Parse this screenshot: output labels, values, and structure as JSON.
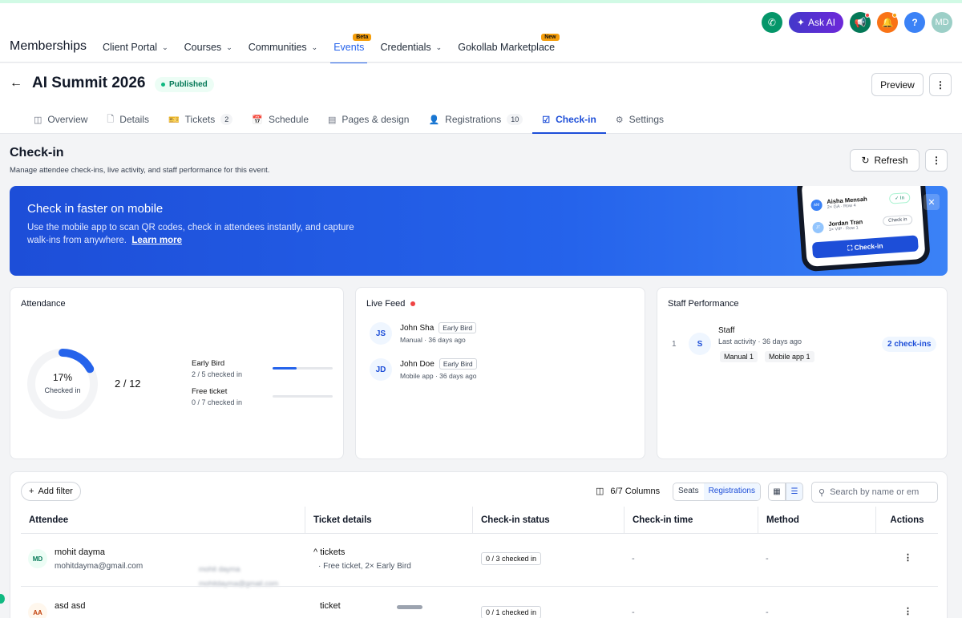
{
  "topbar": {
    "brand": "Memberships",
    "nav": [
      {
        "label": "Client Portal",
        "chevron": true
      },
      {
        "label": "Courses",
        "chevron": true
      },
      {
        "label": "Communities",
        "chevron": true
      },
      {
        "label": "Events",
        "chevron": false,
        "tag": "Beta",
        "active": true
      },
      {
        "label": "Credentials",
        "chevron": true
      },
      {
        "label": "Gokollab Marketplace",
        "chevron": false,
        "tag": "New"
      }
    ],
    "ask_ai": "Ask AI",
    "user_initials": "MD"
  },
  "header": {
    "title": "AI Summit 2026",
    "status": "Published",
    "preview": "Preview",
    "tabs": [
      {
        "label": "Overview"
      },
      {
        "label": "Details"
      },
      {
        "label": "Tickets",
        "count": "2"
      },
      {
        "label": "Schedule"
      },
      {
        "label": "Pages & design"
      },
      {
        "label": "Registrations",
        "count": "10"
      },
      {
        "label": "Check-in",
        "active": true
      },
      {
        "label": "Settings"
      }
    ]
  },
  "checkin": {
    "title": "Check-in",
    "subtitle": "Manage attendee check-ins, live activity, and staff performance for this event.",
    "refresh": "Refresh"
  },
  "banner": {
    "title": "Check in faster on mobile",
    "text": "Use the mobile app to scan QR codes, check in attendees instantly, and capture walk-ins from anywhere.",
    "link": "Learn more",
    "phone": {
      "row1_name": "Aisha Mensah",
      "row1_initials": "AM",
      "row1_sub": "2× GA · Row 4",
      "row1_status": "✓ In",
      "row2_name": "Jordan Tran",
      "row2_initials": "JT",
      "row2_sub": "1× VIP · Row 1",
      "row2_action": "Check in",
      "button": "Check-in"
    }
  },
  "attendance": {
    "title": "Attendance",
    "percent": "17%",
    "percent_value": 0.17,
    "label": "Checked in",
    "ratio": "2 / 12",
    "tickets": [
      {
        "name": "Early Bird",
        "sub": "2 / 5 checked in",
        "fill": 0.4
      },
      {
        "name": "Free ticket",
        "sub": "0 / 7 checked in",
        "fill": 0
      }
    ]
  },
  "live_feed": {
    "title": "Live Feed",
    "items": [
      {
        "initials": "JS",
        "name": "John Sha",
        "ticket": "Early Bird",
        "sub": "Manual · 36 days ago"
      },
      {
        "initials": "JD",
        "name": "John Doe",
        "ticket": "Early Bird",
        "sub": "Mobile app · 36 days ago"
      }
    ]
  },
  "staff": {
    "title": "Staff Performance",
    "rank": "1",
    "initial": "S",
    "name": "Staff",
    "activity": "Last activity · 36 days ago",
    "chips": [
      "Manual 1",
      "Mobile app 1"
    ],
    "count": "2 check-ins"
  },
  "table": {
    "add_filter": "Add filter",
    "columns_label": "6/7 Columns",
    "seg": [
      "Seats",
      "Registrations"
    ],
    "search_placeholder": "Search by name or em",
    "headers": [
      "Attendee",
      "Ticket details",
      "Check-in status",
      "Check-in time",
      "Method",
      "Actions"
    ],
    "rows": [
      {
        "initials": "MD",
        "name": "mohit dayma",
        "email": "mohitdayma@gmail.com",
        "ticket_line1": "^ tickets",
        "ticket_line2": "· Free ticket, 2× Early Bird",
        "status": "0 / 3 checked in",
        "time": "-",
        "method": "-",
        "action": "⋮"
      },
      {
        "initials": "AA",
        "name": "asd asd",
        "email": "",
        "ticket_line1": "ticket",
        "ticket_line2": "",
        "status": "0 / 1 checked in",
        "time": "-",
        "method": "-",
        "action": "⋮"
      }
    ],
    "ghost_name": "mohit dayma",
    "ghost_email": "mohitdayma@gmail.com"
  },
  "colors": {
    "accent": "#1d4ed8",
    "success": "#047857",
    "live": "#ef4444"
  }
}
